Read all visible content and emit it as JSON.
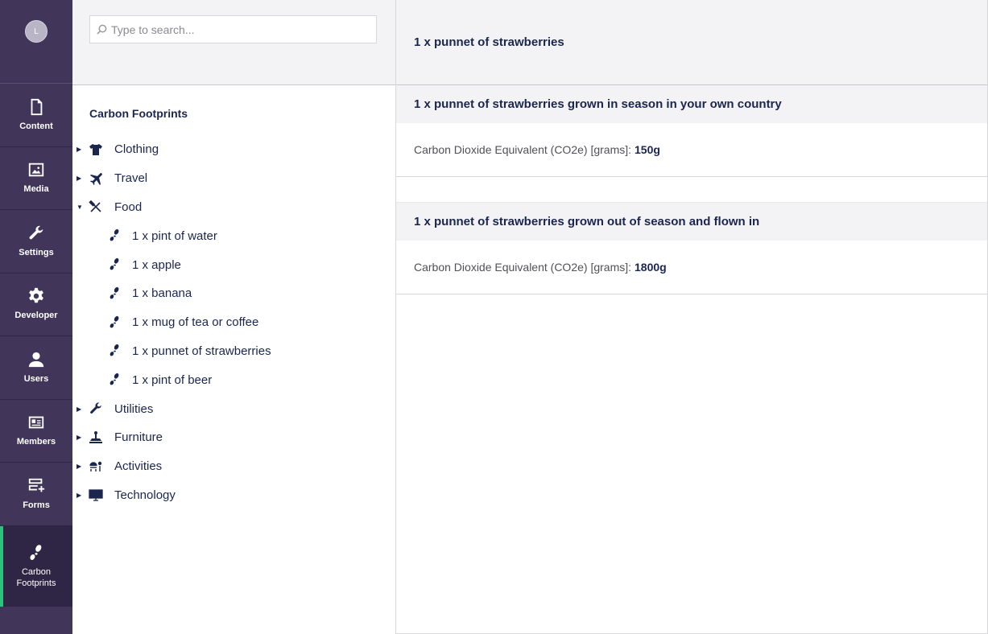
{
  "user": {
    "initial": "L"
  },
  "sections": [
    {
      "label": "Content",
      "icon": "document-icon"
    },
    {
      "label": "Media",
      "icon": "image-icon"
    },
    {
      "label": "Settings",
      "icon": "wrench-icon"
    },
    {
      "label": "Developer",
      "icon": "gear-icon"
    },
    {
      "label": "Users",
      "icon": "user-icon"
    },
    {
      "label": "Members",
      "icon": "id-card-icon"
    },
    {
      "label": "Forms",
      "icon": "form-add-icon"
    },
    {
      "label_line1": "Carbon",
      "label_line2": "Footprints",
      "icon": "footprints-icon",
      "active": true
    }
  ],
  "search": {
    "placeholder": "Type to search..."
  },
  "tree": {
    "root": "Carbon Footprints",
    "items": [
      {
        "label": "Clothing",
        "icon": "tshirt-icon",
        "expanded": false
      },
      {
        "label": "Travel",
        "icon": "plane-icon",
        "expanded": false
      },
      {
        "label": "Food",
        "icon": "cutlery-icon",
        "expanded": true
      },
      {
        "label": "Utilities",
        "icon": "wrench-icon",
        "expanded": false
      },
      {
        "label": "Furniture",
        "icon": "desk-lamp-icon",
        "expanded": false
      },
      {
        "label": "Activities",
        "icon": "activity-icon",
        "expanded": false
      },
      {
        "label": "Technology",
        "icon": "monitor-icon",
        "expanded": false
      }
    ],
    "food_children": [
      "1 x pint of water",
      "1 x apple",
      "1 x banana",
      "1 x mug of tea or coffee",
      "1 x punnet of strawberries",
      "1 x pint of beer"
    ]
  },
  "main": {
    "title": "1 x punnet of strawberries",
    "blocks": [
      {
        "title": "1 x punnet of strawberries grown in season in your own country",
        "label": "Carbon Dioxide Equivalent (CO2e) [grams]:",
        "value": "150g"
      },
      {
        "title": "1 x punnet of strawberries grown out of season and flown in",
        "label": "Carbon Dioxide Equivalent (CO2e) [grams]:",
        "value": "1800g"
      }
    ]
  },
  "colors": {
    "sidebar": "#413659",
    "active_section": "#2f2645",
    "accent": "#2bc37c",
    "text": "#1b264f"
  }
}
